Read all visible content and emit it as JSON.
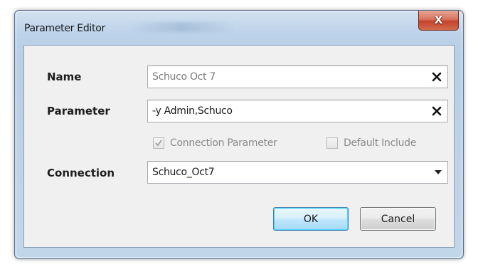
{
  "window": {
    "title": "Parameter Editor",
    "close_glyph": "X"
  },
  "form": {
    "name": {
      "label": "Name",
      "value": "Schuco Oct 7",
      "clear_icon": "x-icon"
    },
    "parameter": {
      "label": "Parameter",
      "value": "-y Admin,Schuco",
      "clear_icon": "x-icon"
    },
    "options": {
      "connection_parameter": {
        "label": "Connection Parameter",
        "checked": true,
        "enabled": false
      },
      "default_include": {
        "label": "Default Include",
        "checked": false,
        "enabled": false
      }
    },
    "connection": {
      "label": "Connection",
      "selected": "Schuco_Oct7",
      "dropdown_icon": "chevron-down-icon"
    }
  },
  "buttons": {
    "ok_label": "OK",
    "cancel_label": "Cancel"
  },
  "colors": {
    "frame": "#b9cfe6",
    "client": "#f0f0f0",
    "close": "#c4432b",
    "ok_border": "#3c7fb1"
  }
}
